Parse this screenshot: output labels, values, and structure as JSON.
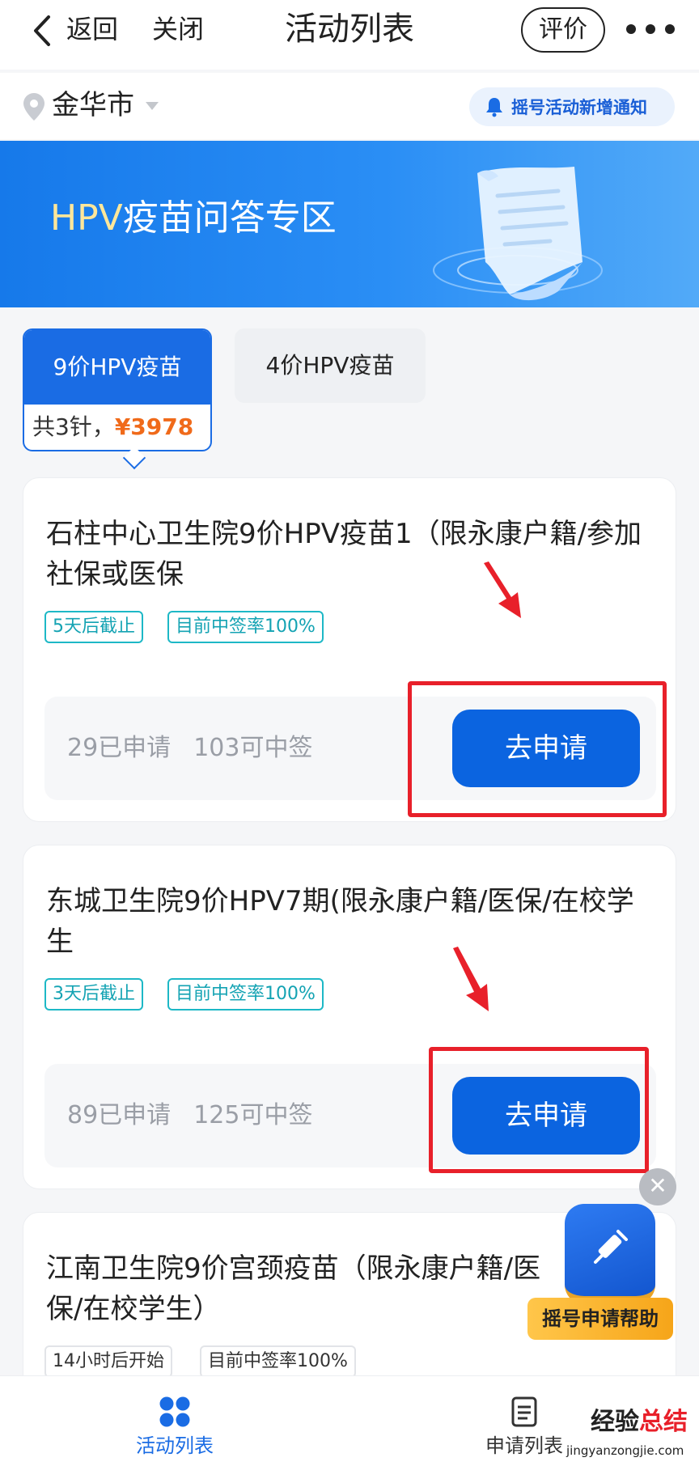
{
  "topbar": {
    "back_label": "返回",
    "close_label": "关闭",
    "title": "活动列表",
    "rate_label": "评价"
  },
  "location": {
    "city": "金华市",
    "notify_label": "摇号活动新增通知"
  },
  "banner": {
    "title_hpv": "HPV",
    "title_rest": "疫苗问答专区"
  },
  "tabs": [
    {
      "label": "9价HPV疫苗",
      "sub_prefix": "共3针，",
      "price": "¥3978",
      "active": true
    },
    {
      "label": "4价HPV疫苗",
      "active": false
    }
  ],
  "cards": [
    {
      "title": "石柱中心卫生院9价HPV疫苗1（限永康户籍/参加社保或医保",
      "tags": [
        "5天后截止",
        "目前中签率100%"
      ],
      "applied": "29已申请",
      "quota": "103可中签",
      "button": "去申请"
    },
    {
      "title": "东城卫生院9价HPV7期(限永康户籍/医保/在校学生",
      "tags": [
        "3天后截止",
        "目前中签率100%"
      ],
      "applied": "89已申请",
      "quota": "125可中签",
      "button": "去申请"
    },
    {
      "title": "江南卫生院9价宫颈疫苗（限永康户籍/医保/在校学生）",
      "tags": [
        "14小时后开始",
        "目前中签率100%"
      ]
    }
  ],
  "floating_help": {
    "close_glyph": "✕",
    "label": "摇号申请帮助"
  },
  "bottom_nav": [
    {
      "label": "活动列表",
      "icon": "grid-icon",
      "active": true,
      "color": "#1a6ce4"
    },
    {
      "label": "申请列表",
      "icon": "document-icon",
      "active": false,
      "color": "#333333"
    }
  ],
  "watermark": {
    "cn_a": "经验",
    "cn_b": "总结",
    "en": "jingyanzongjie.com"
  },
  "colors": {
    "primary": "#0b64e0",
    "price": "#f06a1a",
    "tag": "#14a3b3",
    "highlight": "#e8202a"
  }
}
